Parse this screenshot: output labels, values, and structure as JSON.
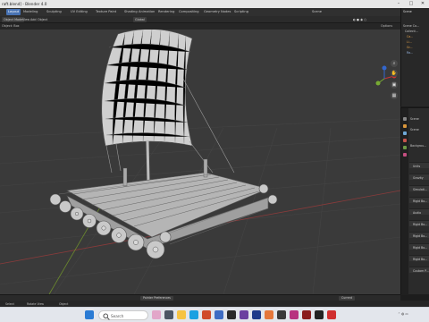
{
  "window": {
    "title": "raft.blend] - Blender 4.0"
  },
  "menubar": {
    "items": [
      "Layout",
      "Modeling",
      "Sculpting",
      "UV Editing",
      "Texture Paint",
      "Shading",
      "Animation",
      "Rendering",
      "Compositing",
      "Geometry Nodes",
      "Scripting"
    ]
  },
  "outliner_header": {
    "scene_label": "Scene"
  },
  "viewport_header": {
    "mode": "Object Mode",
    "view": "View",
    "add": "Add",
    "object": "Object",
    "orientation": "Global",
    "options": "Options"
  },
  "viewport_overlay": {
    "label": "Object: Box"
  },
  "outliner": {
    "rows": [
      "Scene Co...",
      "Collecti...",
      "Ca...",
      "Li...",
      "Gr...",
      "Ra..."
    ]
  },
  "properties": {
    "rows": [
      "Scene",
      "Scene",
      "Backgrou..."
    ],
    "sections": [
      "Units",
      "Gravity",
      "Simulati...",
      "Rigid Bo...",
      "Audio",
      "Rigid Bo...",
      "Rigid Bo...",
      "Rigid Bo...",
      "Rigid Bo...",
      "Custom P..."
    ]
  },
  "timeline": {
    "left": "Pointer Preferences",
    "right": "Current"
  },
  "statusbar": {
    "select": "Select",
    "view": "Rotate View",
    "object": "Object"
  },
  "taskbar": {
    "search_placeholder": "Search"
  },
  "colors": {
    "accent": "#4772b3",
    "viewport_bg": "#3a3a3a",
    "grid_x": "#8a3b3b",
    "grid_y": "#6b8a2d"
  }
}
